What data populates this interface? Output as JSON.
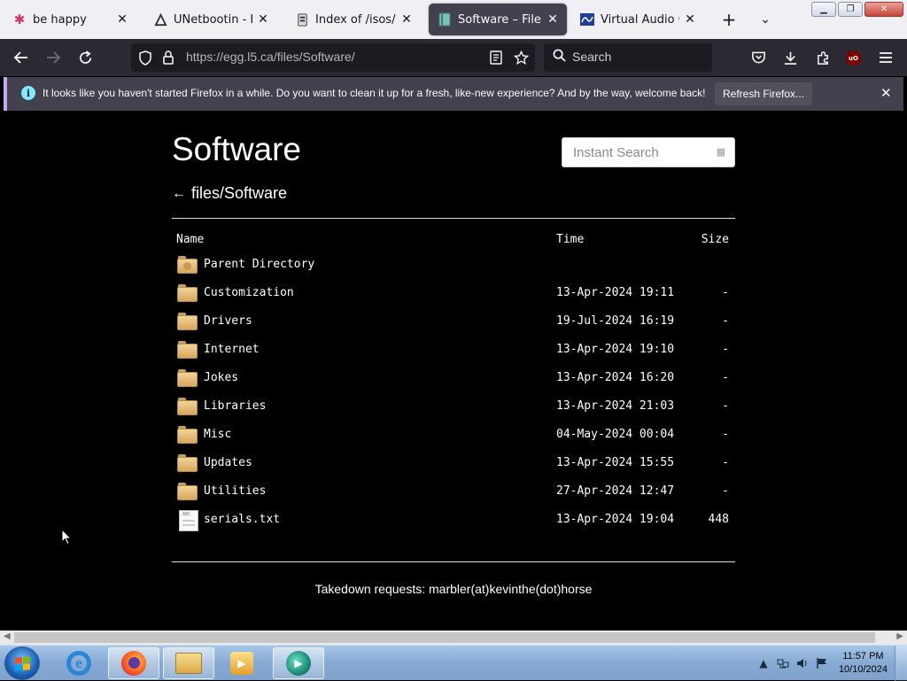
{
  "browser": {
    "tabs": [
      {
        "title": "be happy",
        "icon": "asterisk-icon",
        "active": false
      },
      {
        "title": "UNetbootin - Home",
        "icon": "unetbootin-icon",
        "active": false
      },
      {
        "title": "Index of /isos/",
        "icon": "server-icon",
        "active": false
      },
      {
        "title": "Software – File Directory",
        "icon": "book-icon",
        "active": true
      },
      {
        "title": "Virtual Audio Cable",
        "icon": "vac-icon",
        "active": false
      }
    ],
    "url": "https://egg.l5.ca/files/Software/",
    "search_placeholder": "Search",
    "accent_color": "#c5a4f3"
  },
  "notification": {
    "message": "It looks like you haven't started Firefox in a while. Do you want to clean it up for a fresh, like-new experience? And by the way, welcome back!",
    "button_label": "Refresh Firefox..."
  },
  "page": {
    "title": "Software",
    "search_placeholder": "Instant Search",
    "breadcrumb": "files/Software",
    "headers": {
      "name": "Name",
      "time": "Time",
      "size": "Size"
    },
    "entries": [
      {
        "name": "Parent Directory",
        "time": "",
        "size": "",
        "type": "parent"
      },
      {
        "name": "Customization",
        "time": "13-Apr-2024 19:11",
        "size": "-",
        "type": "folder"
      },
      {
        "name": "Drivers",
        "time": "19-Jul-2024 16:19",
        "size": "-",
        "type": "folder"
      },
      {
        "name": "Internet",
        "time": "13-Apr-2024 19:10",
        "size": "-",
        "type": "folder"
      },
      {
        "name": "Jokes",
        "time": "13-Apr-2024 16:20",
        "size": "-",
        "type": "folder"
      },
      {
        "name": "Libraries",
        "time": "13-Apr-2024 21:03",
        "size": "-",
        "type": "folder"
      },
      {
        "name": "Misc",
        "time": "04-May-2024 00:04",
        "size": "-",
        "type": "folder"
      },
      {
        "name": "Updates",
        "time": "13-Apr-2024 15:55",
        "size": "-",
        "type": "folder"
      },
      {
        "name": "Utilities",
        "time": "27-Apr-2024 12:47",
        "size": "-",
        "type": "folder"
      },
      {
        "name": "serials.txt",
        "time": "13-Apr-2024 19:04",
        "size": "448",
        "type": "file"
      }
    ],
    "footer": "Takedown requests: marbler(at)kevinthe(dot)horse"
  },
  "taskbar": {
    "time": "11:57 PM",
    "date": "10/10/2024"
  }
}
